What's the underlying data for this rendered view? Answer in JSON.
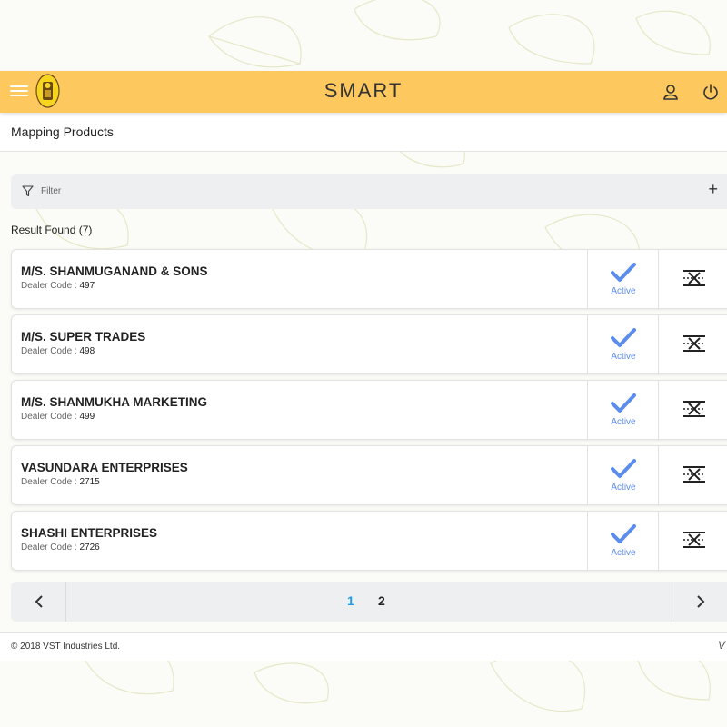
{
  "app": {
    "title": "SMART",
    "colors": {
      "appbar": "#fdc85e",
      "accent": "#5b8def",
      "active_page": "#1e9be6"
    },
    "icons": {
      "menu": "hamburger-menu-icon",
      "logo": "vst-logo",
      "user": "user-icon",
      "power": "power-icon"
    }
  },
  "page": {
    "title": "Mapping Products"
  },
  "filter": {
    "label": "Filter",
    "add_label": "+"
  },
  "results": {
    "count_text": "Result Found (7)"
  },
  "dealers": [
    {
      "name": "M/S. SHANMUGANAND & SONS",
      "code_label": "Dealer Code : ",
      "code": "497",
      "status": "Active"
    },
    {
      "name": "M/S. SUPER TRADES",
      "code_label": "Dealer Code : ",
      "code": "498",
      "status": "Active"
    },
    {
      "name": "M/S. SHANMUKHA MARKETING",
      "code_label": "Dealer Code : ",
      "code": "499",
      "status": "Active"
    },
    {
      "name": "VASUNDARA ENTERPRISES",
      "code_label": "Dealer Code : ",
      "code": "2715",
      "status": "Active"
    },
    {
      "name": "SHASHI ENTERPRISES",
      "code_label": "Dealer Code : ",
      "code": "2726",
      "status": "Active"
    }
  ],
  "pagination": {
    "pages": [
      "1",
      "2"
    ],
    "current": "1"
  },
  "footer": {
    "copyright": "© 2018 VST Industries Ltd.",
    "mark": "V"
  }
}
